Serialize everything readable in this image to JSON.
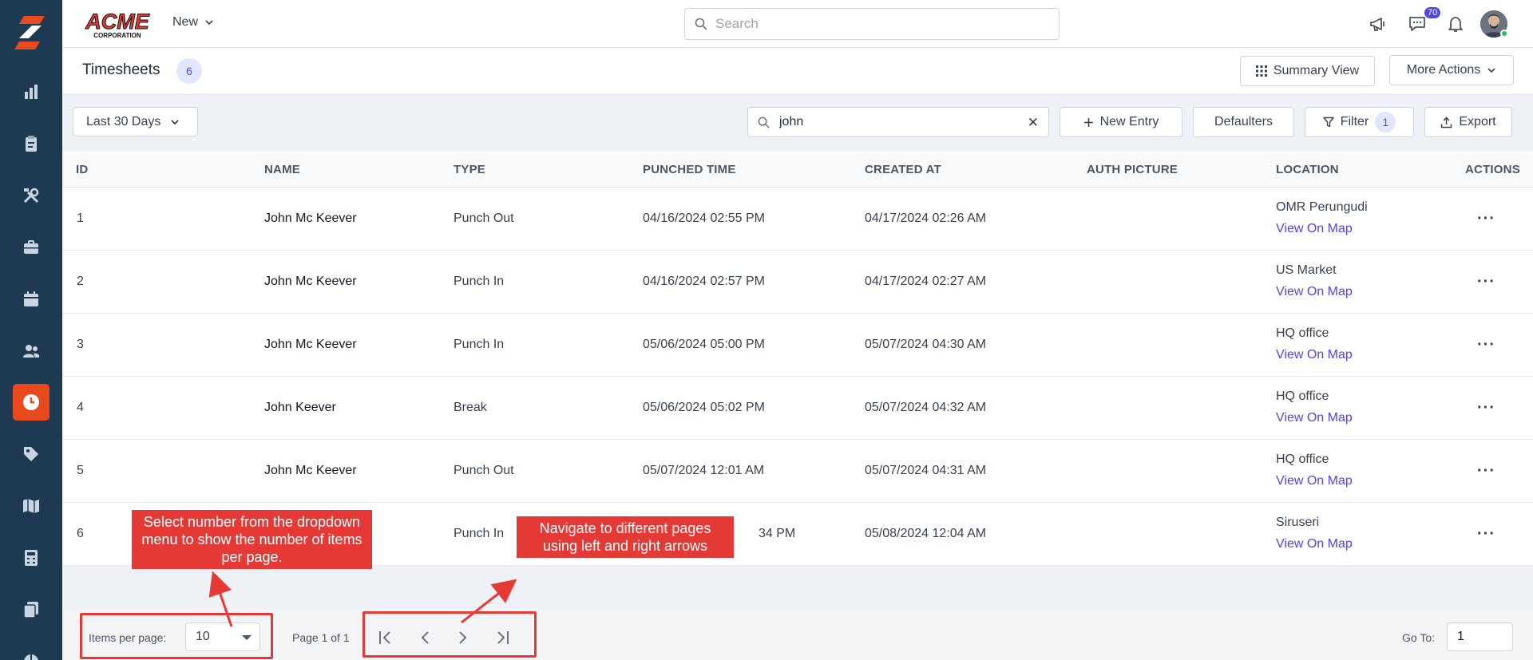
{
  "header": {
    "logo_text": "ACME",
    "logo_sub": "CORPORATION",
    "new_label": "New",
    "search_placeholder": "Search",
    "notification_count": "70"
  },
  "page": {
    "title": "Timesheets",
    "count": "6",
    "summary_view_label": "Summary View",
    "more_actions_label": "More Actions"
  },
  "toolbar": {
    "date_range": "Last 30 Days",
    "search_value": "john",
    "new_entry_label": "New Entry",
    "defaulters_label": "Defaulters",
    "filter_label": "Filter",
    "filter_count": "1",
    "export_label": "Export"
  },
  "table": {
    "columns": [
      "ID",
      "NAME",
      "TYPE",
      "PUNCHED TIME",
      "CREATED AT",
      "AUTH PICTURE",
      "LOCATION",
      "ACTIONS"
    ],
    "map_link_label": "View On Map",
    "rows": [
      {
        "id": "1",
        "name": "John Mc Keever",
        "type": "Punch Out",
        "punched": "04/16/2024 02:55 PM",
        "created": "04/17/2024 02:26 AM",
        "location": "OMR Perungudi"
      },
      {
        "id": "2",
        "name": "John Mc Keever",
        "type": "Punch In",
        "punched": "04/16/2024 02:57 PM",
        "created": "04/17/2024 02:27 AM",
        "location": "US Market"
      },
      {
        "id": "3",
        "name": "John Mc Keever",
        "type": "Punch In",
        "punched": "05/06/2024 05:00 PM",
        "created": "05/07/2024 04:30 AM",
        "location": "HQ office"
      },
      {
        "id": "4",
        "name": "John Keever",
        "type": "Break",
        "punched": "05/06/2024 05:02 PM",
        "created": "05/07/2024 04:32 AM",
        "location": "HQ office"
      },
      {
        "id": "5",
        "name": "John Mc Keever",
        "type": "Punch Out",
        "punched": "05/07/2024 12:01 AM",
        "created": "05/07/2024 04:31 AM",
        "location": "HQ office"
      },
      {
        "id": "6",
        "name": "",
        "type": "Punch In",
        "punched": "34 PM",
        "created": "05/08/2024 12:04 AM",
        "location": "Siruseri"
      }
    ]
  },
  "footer": {
    "items_per_page_label": "Items per page:",
    "items_per_page_value": "10",
    "page_info": "Page 1 of 1",
    "goto_label": "Go To:",
    "goto_value": "1"
  },
  "annotations": {
    "items_callout": "Select number from the dropdown menu to show the number of items per page.",
    "nav_callout": "Navigate to different pages using left and right arrows"
  },
  "colors": {
    "sidebar": "#1e3a52",
    "accent": "#e8491d",
    "link": "#4f46e5",
    "annotation": "#e53935"
  }
}
